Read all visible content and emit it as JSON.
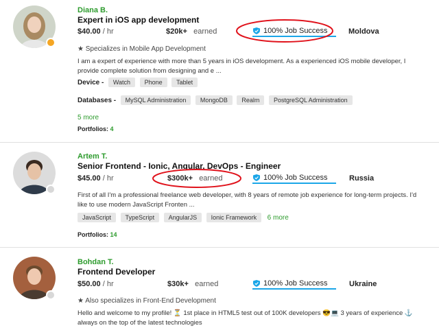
{
  "freelancers": [
    {
      "name": "Diana B.",
      "title": "Expert in iOS app development",
      "rate": "$40.00",
      "rate_unit": "/ hr",
      "earned_amount": "$20k+",
      "earned_label": "earned",
      "job_success": "100% Job Success",
      "country": "Moldova",
      "specializes": "Specializes in Mobile App Development",
      "description_1": "I am a expert of experience with more than 5 years in iOS development. As a experienced iOS mobile developer, I",
      "description_2": "provide complete solution from designing and e ...",
      "device_label": "Device -",
      "device_tags": [
        "Watch",
        "Phone",
        "Tablet"
      ],
      "databases_label": "Databases -",
      "database_tags": [
        "MySQL Administration",
        "MongoDB",
        "Realm",
        "PostgreSQL Administration"
      ],
      "more": "5 more",
      "portfolios_label": "Portfolios:",
      "portfolios_count": "4",
      "status_color": "#f5a623"
    },
    {
      "name": "Artem T.",
      "title": "Senior Frontend - Ionic, Angular, DevOps - Engineer",
      "rate": "$45.00",
      "rate_unit": "/ hr",
      "earned_amount": "$300k+",
      "earned_label": "earned",
      "job_success": "100% Job Success",
      "country": "Russia",
      "description_1": "First of all I'm a professional freelance web developer, with 8 years of remote job experience for long-term projects. I'd",
      "description_2": "like to use modern JavaScript Fronten ...",
      "skill_tags": [
        "JavaScript",
        "TypeScript",
        "AngularJS",
        "Ionic Framework"
      ],
      "more": "6 more",
      "portfolios_label": "Portfolios:",
      "portfolios_count": "14",
      "status_color": "#d8d8d8"
    },
    {
      "name": "Bohdan T.",
      "title": "Frontend Developer",
      "rate": "$50.00",
      "rate_unit": "/ hr",
      "earned_amount": "$30k+",
      "earned_label": "earned",
      "job_success": "100% Job Success",
      "country": "Ukraine",
      "specializes": "Also specializes in Front-End Development",
      "description_1": "Hello and welcome to my profile! ⏳ 1st place in HTML5 test out of 100K developers 😎💻  3 years of experience ⚓",
      "description_2": "always on the top of the latest technologies",
      "status_color": "#d8d8d8"
    }
  ],
  "colors": {
    "accent_green": "#2d9b2d",
    "success_blue": "#1aa6e8",
    "annotation_red": "#e0121b"
  }
}
